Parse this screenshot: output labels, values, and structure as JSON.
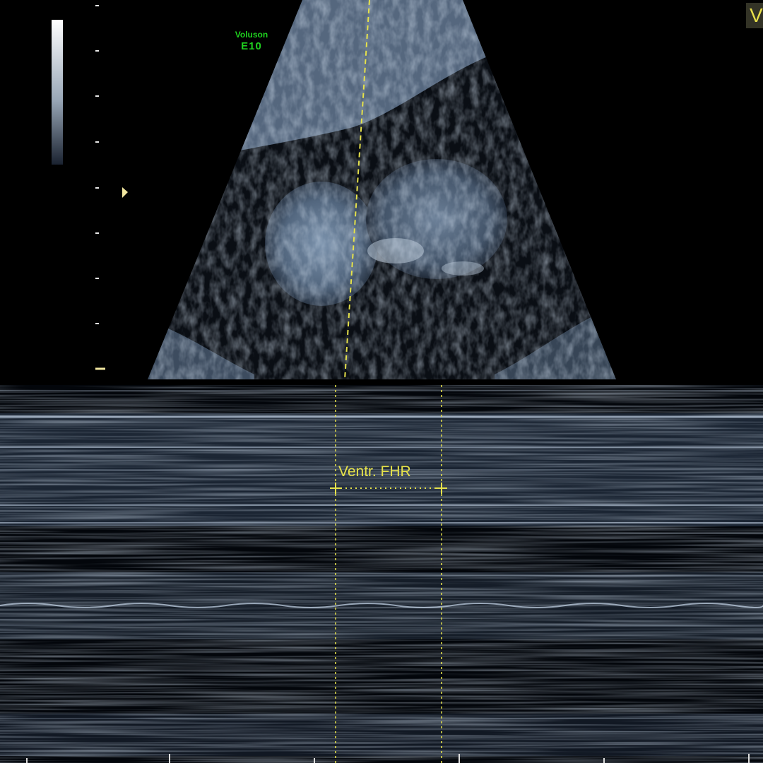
{
  "brand": {
    "manufacturer": "Voluson",
    "model": "E10"
  },
  "mode_badge": "V",
  "measurement": {
    "label": "Ventr. FHR"
  },
  "colors": {
    "background": "#000000",
    "tissue": "#8fa6c0",
    "caliper": "#e6e24a",
    "brand_text": "#1fd11f"
  },
  "icons": {
    "focus_marker": "focus-triangle-icon",
    "caliper_start": "caliper-crosshair-icon",
    "caliper_end": "caliper-crosshair-icon"
  }
}
